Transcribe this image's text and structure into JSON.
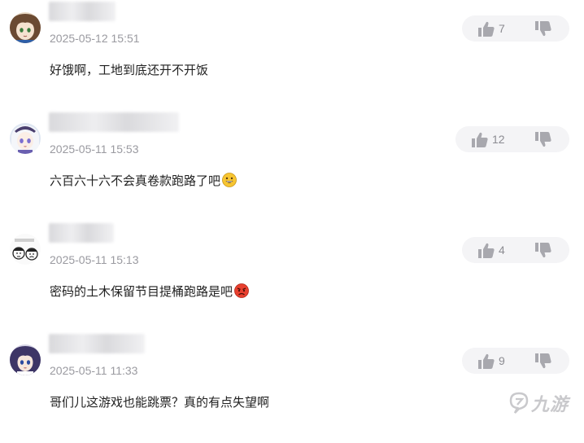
{
  "comments": [
    {
      "timestamp": "2025-05-12 15:51",
      "text": "好饿啊，工地到底还开不开饭",
      "likes": "7",
      "emoji": null,
      "avatar_icon": "avatar-anime-girl-icon"
    },
    {
      "timestamp": "2025-05-11 15:53",
      "text": "六百六十六不会真卷款跑路了吧",
      "likes": "12",
      "emoji": "grinning-face-icon",
      "avatar_icon": "avatar-white-hair-girl-icon"
    },
    {
      "timestamp": "2025-05-11 15:13",
      "text": "密码的土木保留节目提桶跑路是吧",
      "likes": "4",
      "emoji": "angry-face-icon",
      "avatar_icon": "avatar-meme-sketch-icon"
    },
    {
      "timestamp": "2025-05-11 11:33",
      "text": "哥们儿这游戏也能跳票？真的有点失望啊",
      "likes": "9",
      "emoji": null,
      "avatar_icon": "avatar-purple-hair-girl-icon"
    }
  ],
  "icons": {
    "like": "thumbs-up-icon",
    "dislike": "thumbs-down-icon",
    "watermark_logo": "jiuyou-logo-icon"
  },
  "watermark": {
    "text": "九游"
  },
  "colors": {
    "pill_bg": "#f4f4f6",
    "icon_gray": "#a8a8ae",
    "timestamp_gray": "#9a9aa0",
    "text": "#222222"
  }
}
